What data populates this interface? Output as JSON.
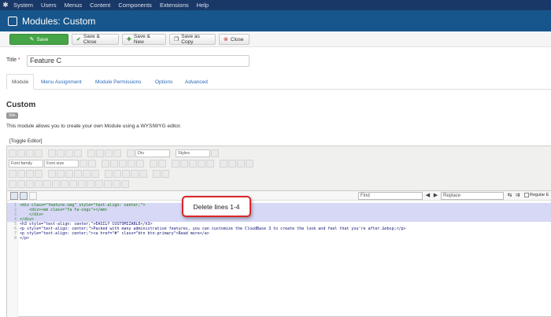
{
  "topnav": {
    "items": [
      "System",
      "Users",
      "Menus",
      "Content",
      "Components",
      "Extensions",
      "Help"
    ]
  },
  "titlebar": {
    "title": "Modules: Custom"
  },
  "toolbar": {
    "save": "Save",
    "save_close": "Save & Close",
    "save_new": "Save & New",
    "save_copy": "Save as Copy",
    "close": "Close"
  },
  "form": {
    "title_label": "Title",
    "required_mark": "*",
    "title_value": "Feature C"
  },
  "tabs": [
    "Module",
    "Menu Assignment",
    "Module Permissions",
    "Options",
    "Advanced"
  ],
  "module": {
    "heading": "Custom",
    "badge": "Site",
    "description": "This module allows you to create your own Module using a WYSIWYG editor.",
    "toggle_editor": "[Toggle Editor]"
  },
  "editor_toolbar": {
    "font_family": "Font family",
    "font_size": "Font size",
    "format_select": "Div",
    "styles_select": "Styles"
  },
  "codemirror": {
    "find_placeholder": "Find",
    "replace_placeholder": "Replace",
    "regex_label": "Regular E"
  },
  "code_lines": [
    {
      "n": "1",
      "text": "<div class=\"feature-img\" style=\"text-align: center;\">"
    },
    {
      "n": "2",
      "text": "    <div><em class=\"fa fa-cogs\"></em>"
    },
    {
      "n": "3",
      "text": "    </div>"
    },
    {
      "n": "4",
      "text": "</div>"
    },
    {
      "n": "5",
      "text": "<h3 style=\"text-align: center;\">EASILY CUSTOMIZABLE</h3>"
    },
    {
      "n": "6",
      "text": "<p style=\"text-align: center;\">Packed with many administrative features, you can customize the CloudBase 3 to create the look and feel that you're after.&nbsp;</p>"
    },
    {
      "n": "7",
      "text": "<p style=\"text-align: center;\"><a href=\"#\" class=\"btn btn-primary\">Read more</a>"
    },
    {
      "n": "8",
      "text": "</p>"
    }
  ],
  "callout": {
    "text": "Delete lines 1-4"
  },
  "colors": {
    "nav_bg": "#1a3867",
    "title_bg": "#17568c",
    "save_green": "#46a546",
    "highlight": "#d6d8f5",
    "callout_border": "#d9262a"
  }
}
